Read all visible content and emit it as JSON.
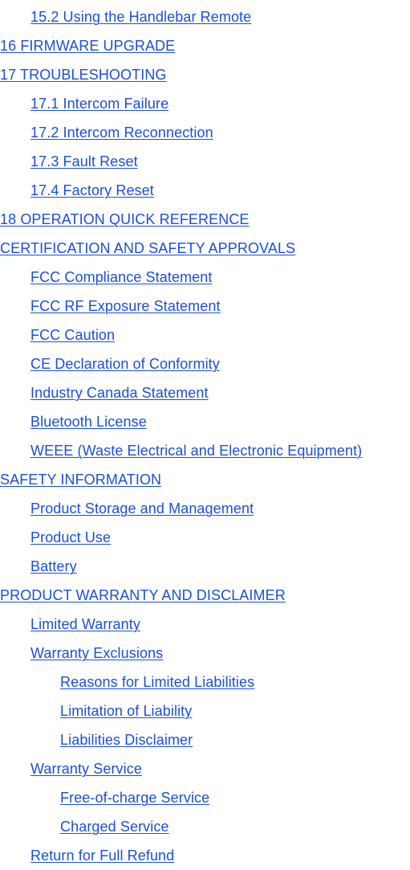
{
  "document": {
    "kind": "table-of-contents",
    "background_color": "#ffffff",
    "link_color": "#1a4fd8",
    "link_decoration": "underline"
  },
  "toc": {
    "entries": [
      {
        "label": "15.2 Using the Handlebar Remote",
        "level": 2
      },
      {
        "label": "16 FIRMWARE UPGRADE",
        "level": 1
      },
      {
        "label": "17 TROUBLESHOOTING",
        "level": 1
      },
      {
        "label": "17.1 Intercom Failure",
        "level": 2
      },
      {
        "label": "17.2 Intercom Reconnection",
        "level": 2
      },
      {
        "label": "17.3 Fault Reset",
        "level": 2
      },
      {
        "label": "17.4 Factory Reset",
        "level": 2
      },
      {
        "label": "18 OPERATION QUICK REFERENCE",
        "level": 1
      },
      {
        "label": "CERTIFICATION AND SAFETY APPROVALS",
        "level": 1
      },
      {
        "label": "FCC Compliance Statement",
        "level": 2
      },
      {
        "label": "FCC RF Exposure Statement",
        "level": 2
      },
      {
        "label": "FCC Caution",
        "level": 2
      },
      {
        "label": "CE Declaration of Conformity",
        "level": 2
      },
      {
        "label": "Industry Canada Statement",
        "level": 2
      },
      {
        "label": "Bluetooth License",
        "level": 2
      },
      {
        "label": "WEEE (Waste Electrical and Electronic Equipment)",
        "level": 2
      },
      {
        "label": "SAFETY INFORMATION",
        "level": 1
      },
      {
        "label": "Product Storage and Management",
        "level": 2
      },
      {
        "label": "Product Use",
        "level": 2
      },
      {
        "label": "Battery",
        "level": 2
      },
      {
        "label": "PRODUCT WARRANTY AND DISCLAIMER",
        "level": 1
      },
      {
        "label": "Limited Warranty",
        "level": 2
      },
      {
        "label": "Warranty Exclusions",
        "level": 2
      },
      {
        "label": "Reasons for Limited Liabilities",
        "level": 3
      },
      {
        "label": "Limitation of Liability",
        "level": 3
      },
      {
        "label": "Liabilities Disclaimer",
        "level": 3
      },
      {
        "label": "Warranty Service",
        "level": 2
      },
      {
        "label": "Free-of-charge Service",
        "level": 3
      },
      {
        "label": "Charged Service",
        "level": 3
      },
      {
        "label": "Return for Full Refund",
        "level": 2
      }
    ]
  }
}
